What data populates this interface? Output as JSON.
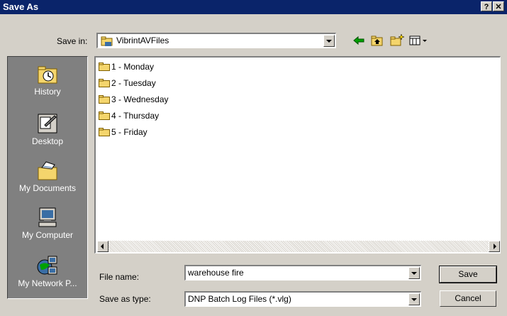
{
  "window": {
    "title": "Save As",
    "help_label": "?",
    "close_label": "✕"
  },
  "toolbar": {
    "save_in_label": "Save in:",
    "save_in_value": "VibrintAVFiles",
    "icons": [
      "back-icon",
      "up-folder-icon",
      "new-folder-icon",
      "view-menu-icon"
    ]
  },
  "places": [
    {
      "label": "History",
      "icon": "history-icon"
    },
    {
      "label": "Desktop",
      "icon": "desktop-icon"
    },
    {
      "label": "My Documents",
      "icon": "my-documents-icon"
    },
    {
      "label": "My Computer",
      "icon": "my-computer-icon"
    },
    {
      "label": "My Network P...",
      "icon": "my-network-places-icon"
    }
  ],
  "files": [
    {
      "name": "1 - Monday"
    },
    {
      "name": "2 - Tuesday"
    },
    {
      "name": "3 - Wednesday"
    },
    {
      "name": "4 - Thursday"
    },
    {
      "name": "5 - Friday"
    }
  ],
  "form": {
    "file_name_label": "File name:",
    "file_name_value": "warehouse fire",
    "save_type_label": "Save as type:",
    "save_type_value": "DNP Batch Log Files (*.vlg)"
  },
  "buttons": {
    "save": "Save",
    "cancel": "Cancel"
  },
  "colors": {
    "titlebar": "#0a246a",
    "dialog": "#d4d0c8",
    "places_bar": "#808080",
    "folder": "#f4d56c"
  }
}
